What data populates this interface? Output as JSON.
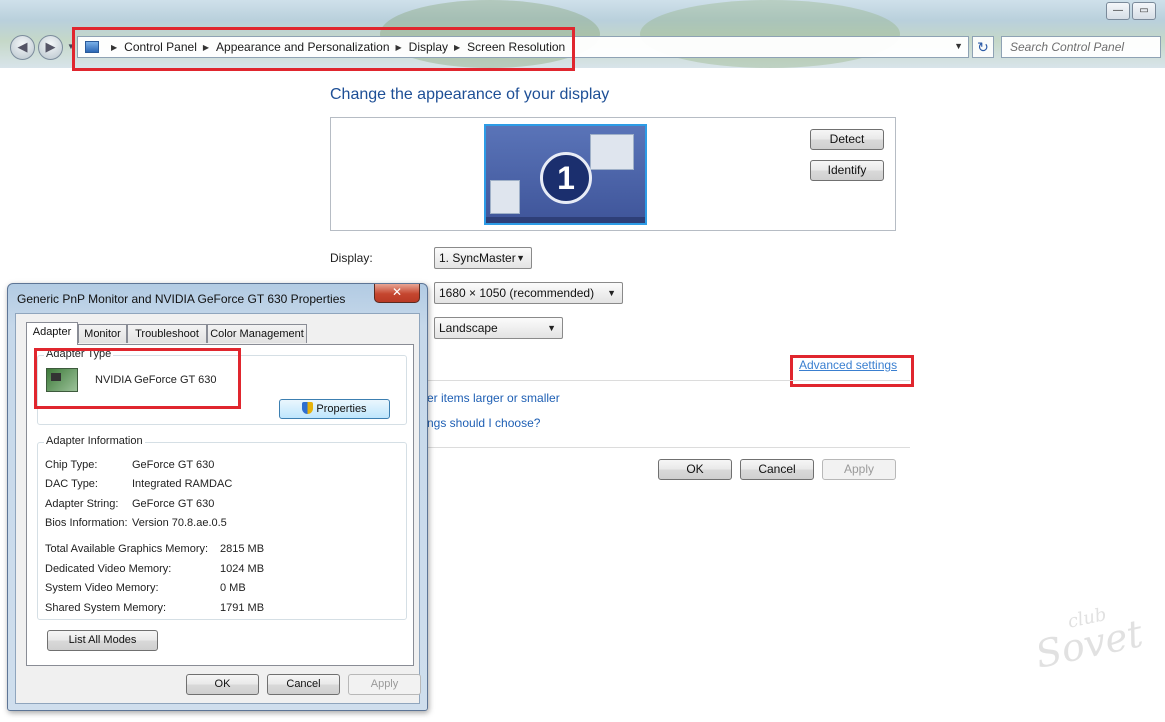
{
  "window": {
    "search_placeholder": "Search Control Panel",
    "breadcrumbs": [
      "Control Panel",
      "Appearance and Personalization",
      "Display",
      "Screen Resolution"
    ]
  },
  "main": {
    "heading": "Change the appearance of your display",
    "monitor_number": "1",
    "detect_label": "Detect",
    "identify_label": "Identify",
    "display_label": "Display:",
    "display_value": "1. SyncMaster",
    "resolution_value": "1680 × 1050 (recommended)",
    "orientation_value": "Landscape",
    "advanced_link": "Advanced settings",
    "link_larger_partial": "er items larger or smaller",
    "link_choose_partial": "ngs should I choose?",
    "ok_label": "OK",
    "cancel_label": "Cancel",
    "apply_label": "Apply"
  },
  "dialog": {
    "title": "Generic PnP Monitor and NVIDIA GeForce GT 630 Properties",
    "close_glyph": "✕",
    "tabs": [
      "Adapter",
      "Monitor",
      "Troubleshoot",
      "Color Management"
    ],
    "adapter_type_title": "Adapter Type",
    "adapter_name": "NVIDIA GeForce GT 630",
    "properties_label": "Properties",
    "adapter_info_title": "Adapter Information",
    "info": [
      {
        "label": "Chip Type:",
        "value": "GeForce GT 630"
      },
      {
        "label": "DAC Type:",
        "value": "Integrated RAMDAC"
      },
      {
        "label": "Adapter String:",
        "value": "GeForce GT 630"
      },
      {
        "label": "Bios Information:",
        "value": "Version 70.8.ae.0.5"
      }
    ],
    "memory": [
      {
        "label": "Total Available Graphics Memory:",
        "value": "2815 MB"
      },
      {
        "label": "Dedicated Video Memory:",
        "value": "1024 MB"
      },
      {
        "label": "System Video Memory:",
        "value": "0 MB"
      },
      {
        "label": "Shared System Memory:",
        "value": "1791 MB"
      }
    ],
    "list_modes_label": "List All Modes",
    "ok_label": "OK",
    "cancel_label": "Cancel",
    "apply_label": "Apply"
  },
  "watermark": {
    "line1": "club",
    "line2": "Sovet"
  },
  "colors": {
    "highlight": "#e0262e",
    "heading": "#1e4f96",
    "link": "#1e5fb4"
  }
}
